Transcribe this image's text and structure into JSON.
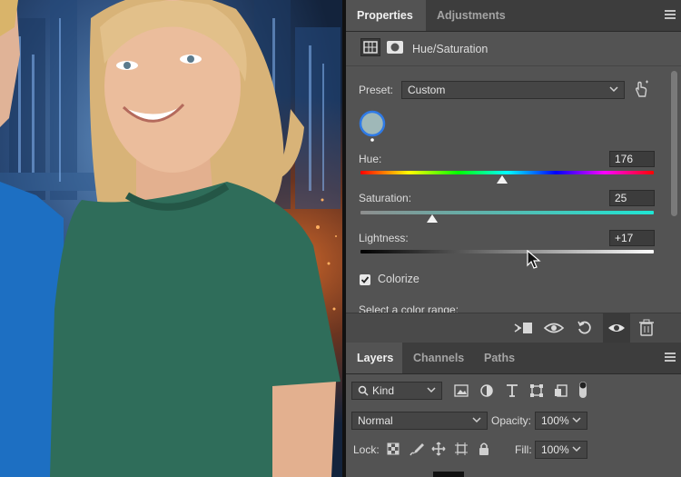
{
  "properties_panel": {
    "tabs": [
      {
        "label": "Properties",
        "active": true
      },
      {
        "label": "Adjustments",
        "active": false
      }
    ],
    "adjustment_name": "Hue/Saturation",
    "preset": {
      "label": "Preset:",
      "value": "Custom"
    },
    "hue": {
      "label": "Hue:",
      "value": "176"
    },
    "saturation": {
      "label": "Saturation:",
      "value": "25"
    },
    "lightness": {
      "label": "Lightness:",
      "value": "+17"
    },
    "colorize": {
      "label": "Colorize",
      "checked": true
    },
    "color_range_label": "Select a color range:",
    "swatch_color": "#9fb8b8",
    "bottom_icons": [
      "clip-to-layer-icon",
      "view-previous-icon",
      "reset-icon",
      "visibility-eye-icon",
      "trash-icon"
    ]
  },
  "layers_panel": {
    "tabs": [
      {
        "label": "Layers",
        "active": true
      },
      {
        "label": "Channels",
        "active": false
      },
      {
        "label": "Paths",
        "active": false
      }
    ],
    "filter_kind": "Kind",
    "blend_mode": "Normal",
    "opacity": {
      "label": "Opacity:",
      "value": "100%"
    },
    "lock_label": "Lock:",
    "fill": {
      "label": "Fill:",
      "value": "100%"
    }
  },
  "colors": {
    "panel_bg": "#535353",
    "tab_bar_bg": "#3d3d3d",
    "shirt_green": "#2f6d5a",
    "shirt_blue": "#1d6fc2"
  }
}
